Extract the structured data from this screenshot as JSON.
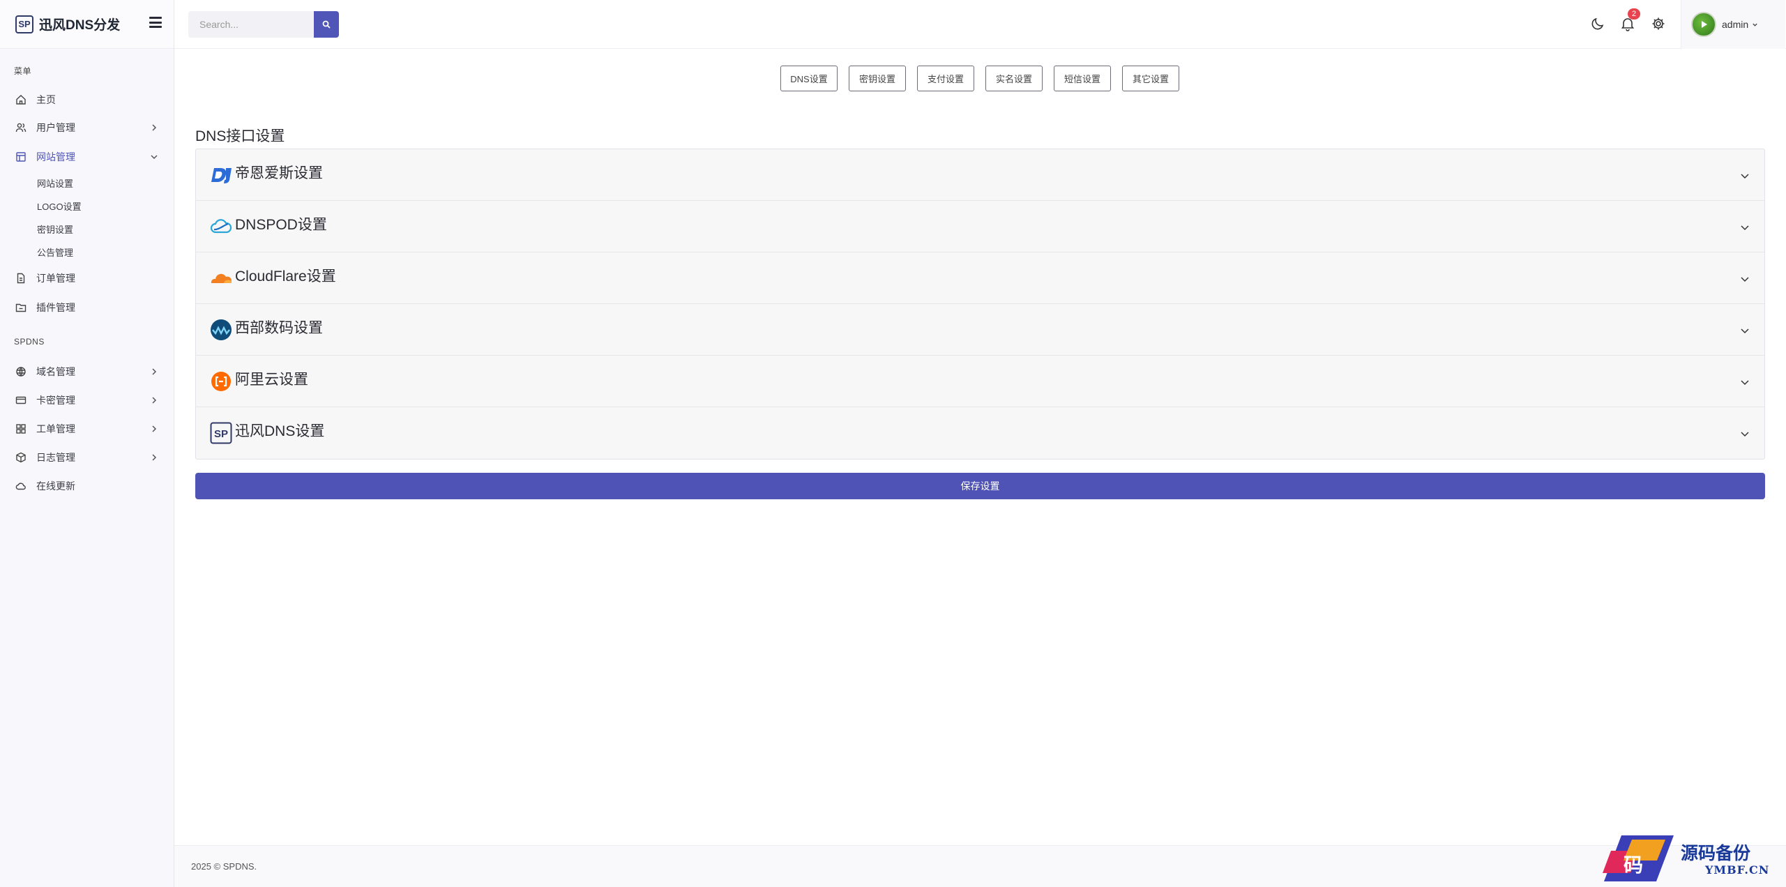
{
  "brand": {
    "logo_text": "SP",
    "title": "迅风DNS分发"
  },
  "sidebar": {
    "section_menu": "菜单",
    "section_spdns": "SPDNS",
    "items": [
      {
        "label": "主页",
        "icon": "home-icon"
      },
      {
        "label": "用户管理",
        "icon": "users-icon"
      },
      {
        "label": "网站管理",
        "icon": "layout-icon"
      },
      {
        "label": "订单管理",
        "icon": "file-icon"
      },
      {
        "label": "插件管理",
        "icon": "folder-icon"
      },
      {
        "label": "域名管理",
        "icon": "globe-icon"
      },
      {
        "label": "卡密管理",
        "icon": "card-icon"
      },
      {
        "label": "工单管理",
        "icon": "grid-icon"
      },
      {
        "label": "日志管理",
        "icon": "box-icon"
      },
      {
        "label": "在线更新",
        "icon": "cloud-icon"
      }
    ],
    "sub_items": [
      "网站设置",
      "LOGO设置",
      "密钥设置",
      "公告管理"
    ]
  },
  "topbar": {
    "search_placeholder": "Search...",
    "notification_count": "2",
    "user_name": "admin"
  },
  "tabs": [
    "DNS设置",
    "密钥设置",
    "支付设置",
    "实名设置",
    "短信设置",
    "其它设置"
  ],
  "main": {
    "heading": "DNS接口设置",
    "providers": [
      {
        "title": "帝恩爱斯设置",
        "icon": "dns-logo-icon"
      },
      {
        "title": "DNSPOD设置",
        "icon": "dnspod-logo-icon"
      },
      {
        "title": "CloudFlare设置",
        "icon": "cloudflare-logo-icon"
      },
      {
        "title": "西部数码设置",
        "icon": "west-digital-logo-icon"
      },
      {
        "title": "阿里云设置",
        "icon": "aliyun-logo-icon"
      },
      {
        "title": "迅风DNS设置",
        "icon": "sp-logo-icon"
      }
    ],
    "save_label": "保存设置"
  },
  "footer": {
    "text": "2025 © SPDNS."
  },
  "watermark": {
    "text": "源码备份",
    "sub": "YMBF.CN"
  },
  "colors": {
    "accent": "#4f53b5",
    "badge": "#e8444f"
  }
}
